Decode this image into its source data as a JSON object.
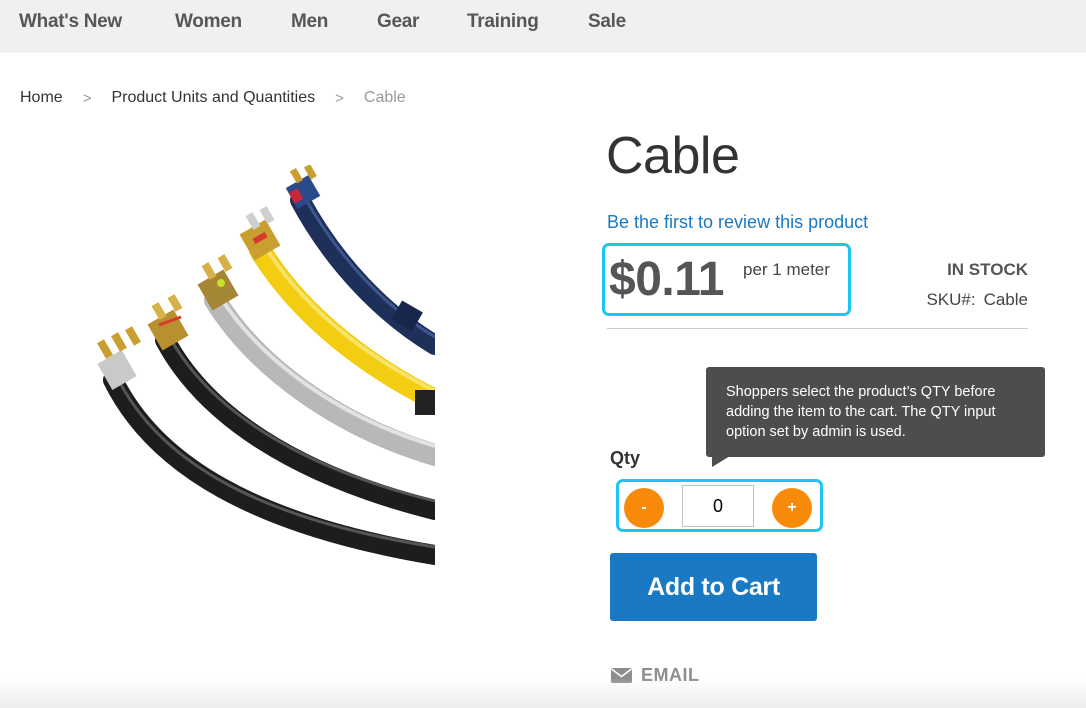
{
  "nav": {
    "items": [
      {
        "label": "What's New"
      },
      {
        "label": "Women"
      },
      {
        "label": "Men"
      },
      {
        "label": "Gear"
      },
      {
        "label": "Training"
      },
      {
        "label": "Sale"
      }
    ]
  },
  "breadcrumb": {
    "items": [
      {
        "label": "Home"
      },
      {
        "label": "Product Units and Quantities"
      }
    ],
    "separator": ">",
    "current": "Cable"
  },
  "product": {
    "image_icon": "product-image-rca-cables",
    "title": "Cable",
    "review_link": "Be the first to review this product",
    "price": "$0.11",
    "price_unit": "per 1 meter",
    "stock_status": "IN STOCK",
    "sku_label": "SKU#:",
    "sku_value": "Cable"
  },
  "tooltip": {
    "text": "Shoppers select the product’s QTY before adding the item to the cart. The QTY input option set by admin is used."
  },
  "qty": {
    "label": "Qty",
    "minus_label": "-",
    "plus_label": "+",
    "value": "0"
  },
  "actions": {
    "add_to_cart": "Add to Cart",
    "email": "EMAIL",
    "email_icon": "envelope-icon"
  },
  "colors": {
    "highlight": "#1cc6f1",
    "primary": "#1979c3",
    "qty_button": "#f88a0b",
    "tooltip_bg": "#4d4d4d",
    "nav_bg": "#f0f0f0"
  }
}
